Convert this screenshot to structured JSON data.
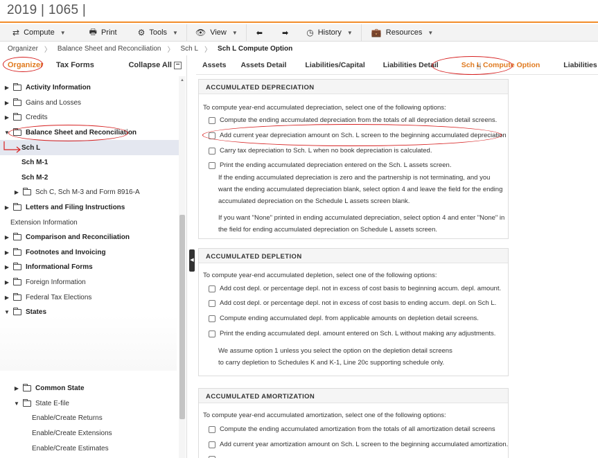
{
  "app": {
    "title": "2019 | 1065 |"
  },
  "toolbar": {
    "compute": "Compute",
    "print": "Print",
    "tools": "Tools",
    "view": "View",
    "history": "History",
    "resources": "Resources"
  },
  "breadcrumb": [
    "Organizer",
    "Balance Sheet and Reconciliation",
    "Sch L",
    "Sch L Compute Option"
  ],
  "left": {
    "tab_organizer": "Organizer",
    "tab_taxforms": "Tax Forms",
    "collapse_all": "Collapse All",
    "tree": [
      {
        "label": "Activity Information",
        "bold": true,
        "arrow": "▶",
        "folder": true,
        "indent": 0
      },
      {
        "label": "Gains and Losses",
        "bold": false,
        "arrow": "▶",
        "folder": true,
        "indent": 0
      },
      {
        "label": "Credits",
        "bold": false,
        "arrow": "▶",
        "folder": true,
        "indent": 0
      },
      {
        "label": "Balance Sheet and Reconciliation",
        "bold": true,
        "arrow": "▼",
        "folder": true,
        "indent": 0
      },
      {
        "label": "Sch L",
        "bold": true,
        "arrow": "",
        "folder": false,
        "indent": 1,
        "selected": true
      },
      {
        "label": "Sch M-1",
        "bold": true,
        "arrow": "",
        "folder": false,
        "indent": 1
      },
      {
        "label": "Sch M-2",
        "bold": true,
        "arrow": "",
        "folder": false,
        "indent": 1
      },
      {
        "label": "Sch C, Sch M-3 and Form 8916-A",
        "bold": false,
        "arrow": "▶",
        "folder": true,
        "indent": 1
      },
      {
        "label": "Letters and Filing Instructions",
        "bold": true,
        "arrow": "▶",
        "folder": true,
        "indent": 0
      },
      {
        "label": "Extension Information",
        "bold": false,
        "arrow": "",
        "folder": false,
        "indent": 0
      },
      {
        "label": "Comparison and Reconciliation",
        "bold": true,
        "arrow": "▶",
        "folder": true,
        "indent": 0
      },
      {
        "label": "Footnotes and Invoicing",
        "bold": true,
        "arrow": "▶",
        "folder": true,
        "indent": 0
      },
      {
        "label": "Informational Forms",
        "bold": true,
        "arrow": "▶",
        "folder": true,
        "indent": 0
      },
      {
        "label": "Foreign Information",
        "bold": false,
        "arrow": "▶",
        "folder": true,
        "indent": 0
      },
      {
        "label": "Federal Tax Elections",
        "bold": false,
        "arrow": "▶",
        "folder": true,
        "indent": 0
      },
      {
        "label": "States",
        "bold": true,
        "arrow": "▼",
        "folder": true,
        "indent": 0
      }
    ],
    "tree_bottom": [
      {
        "label": "Common State",
        "bold": true,
        "arrow": "▶",
        "folder": true,
        "indent": 1
      },
      {
        "label": "State E-file",
        "bold": false,
        "arrow": "▼",
        "folder": true,
        "indent": 1
      },
      {
        "label": "Enable/Create Returns",
        "bold": false,
        "arrow": "",
        "folder": false,
        "indent": 2
      },
      {
        "label": "Enable/Create Extensions",
        "bold": false,
        "arrow": "",
        "folder": false,
        "indent": 2
      },
      {
        "label": "Enable/Create Estimates",
        "bold": false,
        "arrow": "",
        "folder": false,
        "indent": 2
      }
    ]
  },
  "tabs": [
    "Assets",
    "Assets Detail",
    "Liabilities/Capital",
    "Liabilities Detail",
    "Sch L Compute Option",
    "Liabilities Alloc."
  ],
  "sections": {
    "depreciation": {
      "title": "ACCUMULATED DEPRECIATION",
      "intro": "To compute year-end accumulated depreciation, select one of the following options:",
      "options": [
        "Compute the ending accumulated depreciation from the totals of all depreciation detail screens.",
        "Add current year depreciation amount on Sch. L screen to the beginning accumulated depreciation",
        "Carry tax depreciation to Sch. L when no book depreciation is calculated.",
        "Print the ending accumulated depreciation entered on the Sch. L assets screen."
      ],
      "note1": [
        "If the ending accumulated depreciation is zero and the partnership is not terminating, and you",
        "want the ending accumulated depreciation blank, select option 4 and leave the field for the ending",
        "accumulated depreciation on the Schedule L assets screen blank."
      ],
      "note2": [
        "If you want \"None\" printed in ending accumulated depreciation, select option 4 and enter \"None\" in",
        "the field for ending accumulated depreciation on Schedule L assets screen."
      ]
    },
    "depletion": {
      "title": "ACCUMULATED DEPLETION",
      "intro": "To compute year-end accumulated depletion, select one of the following options:",
      "options": [
        "Add cost depl. or percentage depl. not in excess of cost basis to beginning accum. depl. amount.",
        "Add cost depl. or percentage depl. not in excess of cost basis to ending accum. depl. on Sch L.",
        "Compute ending accumulated depl. from applicable amounts on depletion detail screens.",
        "Print the ending accumulated depl. amount entered on Sch. L without making any adjustments."
      ],
      "note": [
        "We assume option 1 unless you select the option on the depletion detail screens",
        "to carry depletion to Schedules K and K-1, Line 20c supporting schedule only."
      ]
    },
    "amortization": {
      "title": "ACCUMULATED AMORTIZATION",
      "intro": "To compute year-end accumulated amortization, select one of the following options:",
      "options": [
        "Compute the ending accumulated amortization from the totals of all amortization detail screens",
        "Add current year amortization amount on Sch. L screen to the beginning accumulated amortization."
      ]
    }
  },
  "colors": {
    "accent": "#e07a1f",
    "annotation": "#d61f1f",
    "selected_row": "#e4e7f0"
  }
}
